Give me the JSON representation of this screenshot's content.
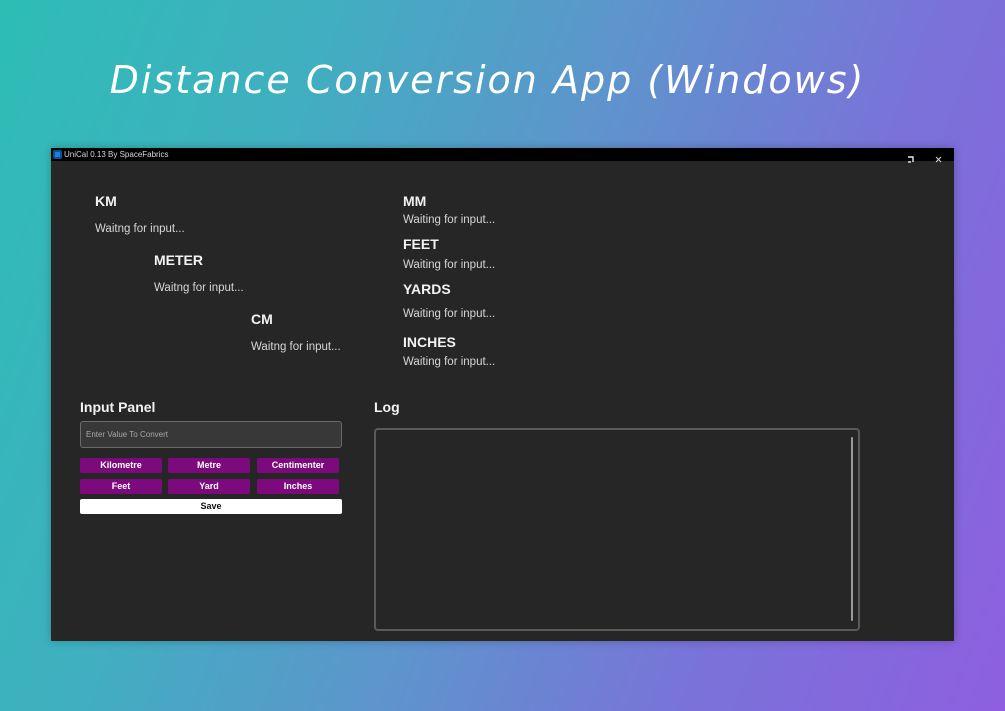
{
  "banner": {
    "title": "Distance Conversion App (Windows)"
  },
  "window": {
    "title": "UniCal 0.13 By SpaceFabrics",
    "controls": {
      "restore_icon": "restore-icon",
      "close_icon": "close-icon"
    }
  },
  "outputs": {
    "km": {
      "label": "KM",
      "value": "Waitng for input..."
    },
    "meter": {
      "label": "METER",
      "value": "Waitng for input..."
    },
    "cm": {
      "label": "CM",
      "value": "Waitng for input..."
    },
    "mm": {
      "label": "MM",
      "value": "Waiting for input..."
    },
    "feet": {
      "label": "FEET",
      "value": "Waiting for input..."
    },
    "yards": {
      "label": "YARDS",
      "value": "Waiting for input..."
    },
    "inches": {
      "label": "INCHES",
      "value": "Waiting for input..."
    }
  },
  "input_panel": {
    "title": "Input Panel",
    "input_value": "",
    "input_placeholder": "Enter Value To Convert",
    "buttons": {
      "kilometre": "Kilometre",
      "metre": "Metre",
      "centimeter": "Centimenter",
      "feet": "Feet",
      "yard": "Yard",
      "inches": "Inches"
    },
    "save_label": "Save"
  },
  "log": {
    "title": "Log",
    "content": ""
  },
  "colors": {
    "window_bg": "#262626",
    "titlebar_bg": "#000000",
    "button_accent": "#7d0a7d",
    "save_bg": "#ffffff"
  }
}
